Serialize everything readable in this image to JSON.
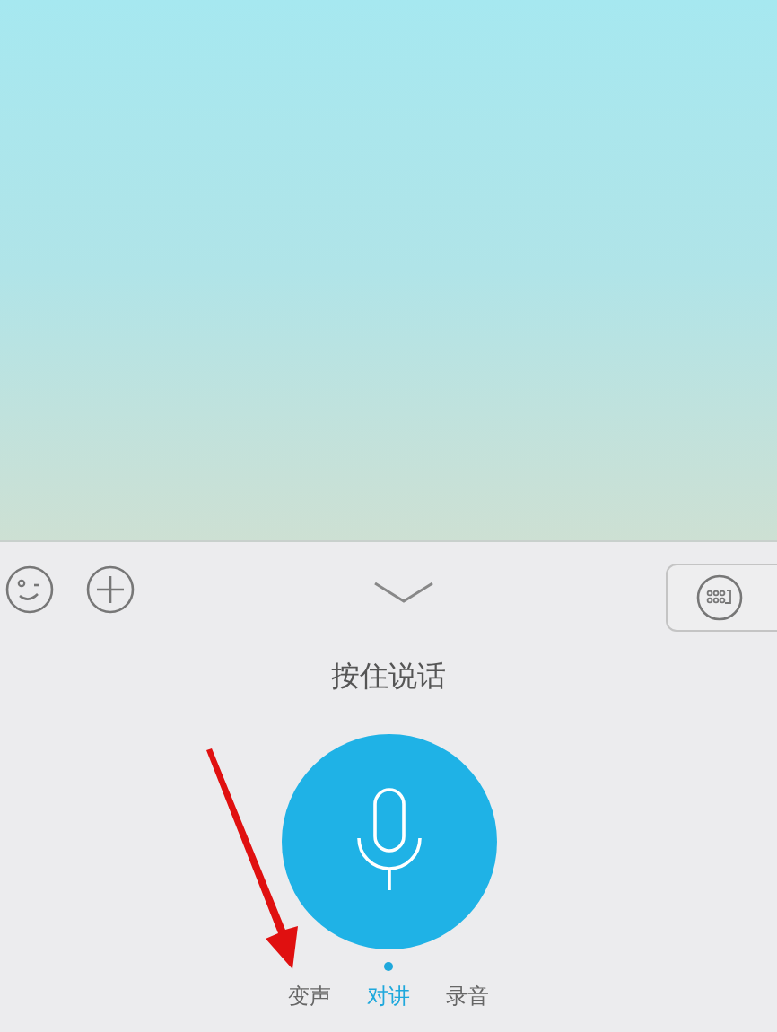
{
  "voice_panel": {
    "hint": "按住说话",
    "modes": [
      {
        "label": "变声",
        "selected": false
      },
      {
        "label": "对讲",
        "selected": true
      },
      {
        "label": "录音",
        "selected": false
      }
    ]
  }
}
